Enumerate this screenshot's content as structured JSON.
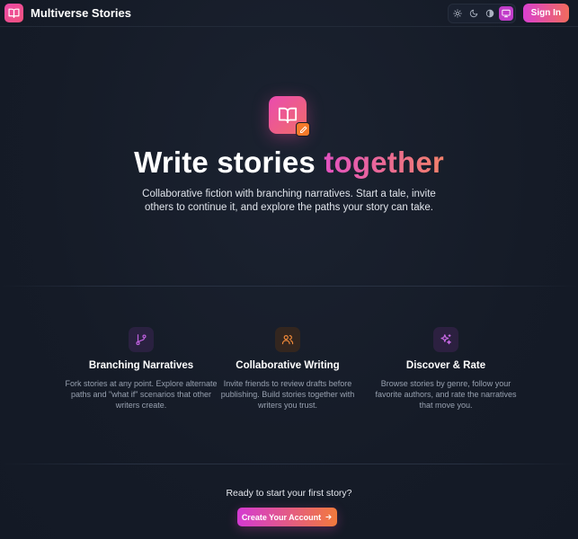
{
  "header": {
    "brand_name": "Multiverse Stories",
    "signin_label": "Sign In",
    "theme_options": [
      "sun-icon",
      "moon-icon",
      "contrast-icon",
      "monitor-icon"
    ],
    "active_theme": "monitor-icon"
  },
  "hero": {
    "title_main": "Write stories ",
    "title_accent": "together",
    "subtitle": "Collaborative fiction with branching narratives. Start a tale, invite others to continue it, and explore the paths your story can take."
  },
  "features": [
    {
      "icon": "git-branch-icon",
      "title": "Branching Narratives",
      "description": "Fork stories at any point. Explore alternate paths and \"what if\" scenarios that other writers create."
    },
    {
      "icon": "users-icon",
      "title": "Collaborative Writing",
      "description": "Invite friends to review drafts before publishing. Build stories together with writers you trust."
    },
    {
      "icon": "sparkles-icon",
      "title": "Discover & Rate",
      "description": "Browse stories by genre, follow your favorite authors, and rate the narratives that move you."
    }
  ],
  "cta": {
    "prompt": "Ready to start your first story?",
    "button_label": "Create Your Account"
  },
  "colors": {
    "background": "#151b27",
    "accent_pink": "#e84bb0",
    "accent_orange": "#f47a2a"
  }
}
